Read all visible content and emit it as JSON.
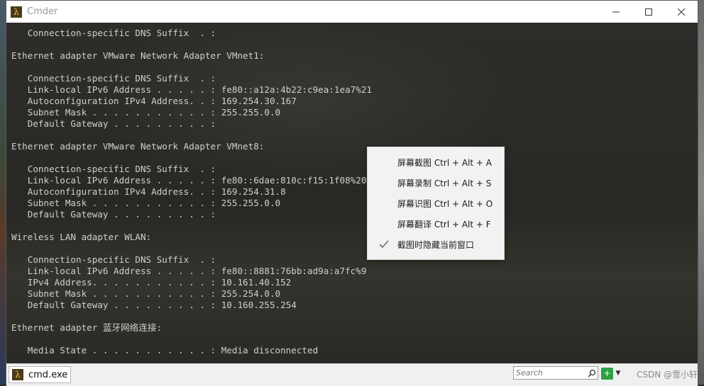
{
  "window": {
    "title": "Cmder",
    "controls": {
      "minimize": "─",
      "maximize": "☐",
      "close": "✕"
    }
  },
  "terminal": {
    "lines": [
      "   Connection-specific DNS Suffix  . :",
      "",
      "Ethernet adapter VMware Network Adapter VMnet1:",
      "",
      "   Connection-specific DNS Suffix  . :",
      "   Link-local IPv6 Address . . . . . : fe80::a12a:4b22:c9ea:1ea7%21",
      "   Autoconfiguration IPv4 Address. . : 169.254.30.167",
      "   Subnet Mask . . . . . . . . . . . : 255.255.0.0",
      "   Default Gateway . . . . . . . . . :",
      "",
      "Ethernet adapter VMware Network Adapter VMnet8:",
      "",
      "   Connection-specific DNS Suffix  . :",
      "   Link-local IPv6 Address . . . . . : fe80::6dae:810c:f15:1f08%20",
      "   Autoconfiguration IPv4 Address. . : 169.254.31.8",
      "   Subnet Mask . . . . . . . . . . . : 255.255.0.0",
      "   Default Gateway . . . . . . . . . :",
      "",
      "Wireless LAN adapter WLAN:",
      "",
      "   Connection-specific DNS Suffix  . :",
      "   Link-local IPv6 Address . . . . . : fe80::8881:76bb:ad9a:a7fc%9",
      "   IPv4 Address. . . . . . . . . . . : 10.161.40.152",
      "   Subnet Mask . . . . . . . . . . . : 255.254.0.0",
      "   Default Gateway . . . . . . . . . : 10.160.255.254",
      "",
      "Ethernet adapter 蓝牙网络连接:",
      "",
      "   Media State . . . . . . . . . . . : Media disconnected"
    ]
  },
  "context_menu": {
    "items": [
      {
        "label": "屏幕截图 Ctrl + Alt + A",
        "checked": false
      },
      {
        "label": "屏幕录制 Ctrl + Alt + S",
        "checked": false
      },
      {
        "label": "屏幕识图 Ctrl + Alt + O",
        "checked": false
      },
      {
        "label": "屏幕翻译 Ctrl + Alt + F",
        "checked": false
      },
      {
        "label": "截图时隐藏当前窗口",
        "checked": true
      }
    ]
  },
  "statusbar": {
    "tab_label": "cmd.exe",
    "search_placeholder": "Search",
    "watermark": "CSDN @雪小轩"
  },
  "colors": {
    "terminal_text": "#cfcfcf",
    "add_button": "#2ea043",
    "icon_bg": "#4b3a1a",
    "icon_fg": "#f0c040"
  },
  "icons": {
    "app": "lambda-icon",
    "search": "search-icon",
    "add": "add-console-icon",
    "dropdown": "dropdown-icon",
    "check": "check-icon"
  }
}
